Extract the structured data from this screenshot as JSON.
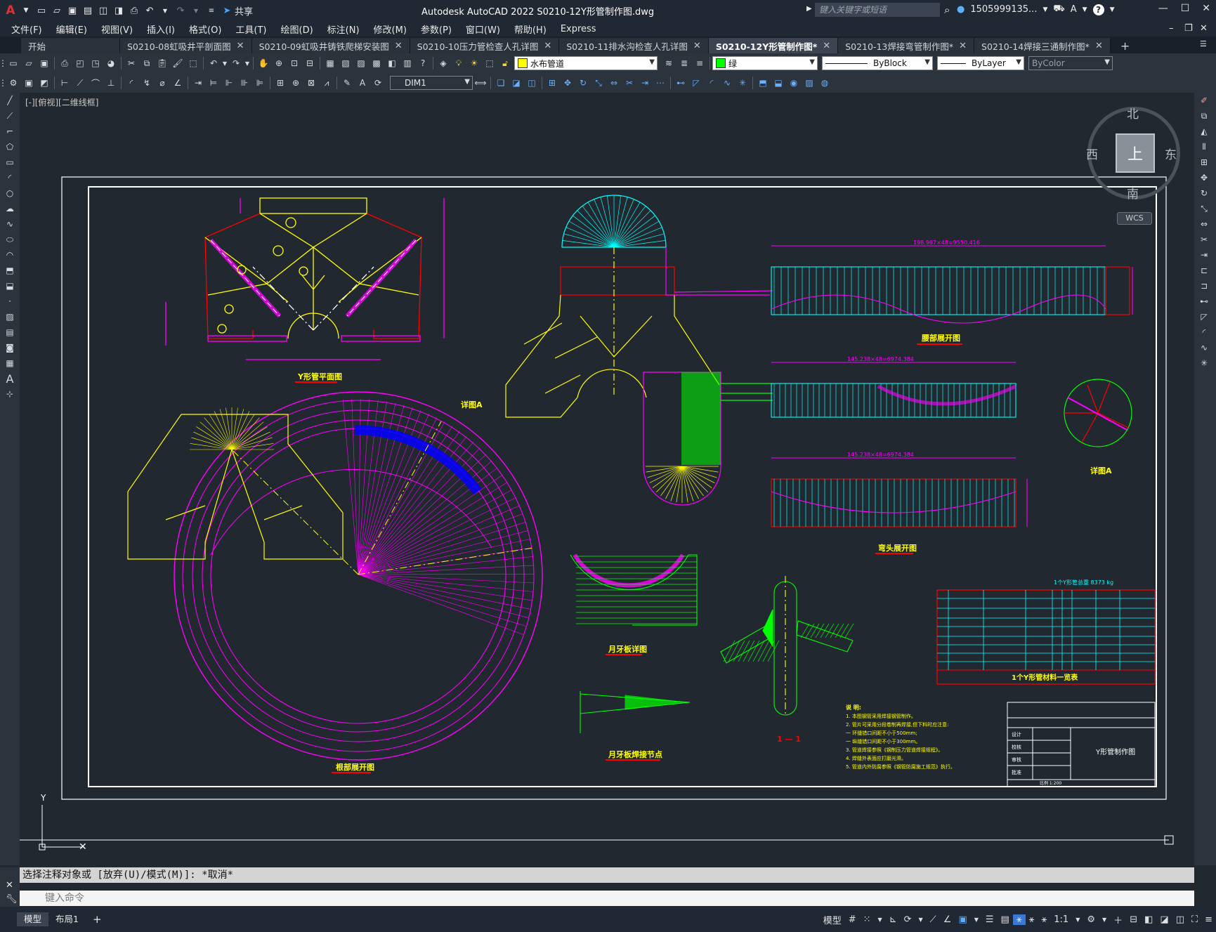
{
  "window": {
    "title": "Autodesk AutoCAD 2022    S0210-12Y形管制作图.dwg",
    "search_placeholder": "键入关键字或短语",
    "user": "1505999135...",
    "share_label": "共享"
  },
  "menu": [
    "文件(F)",
    "编辑(E)",
    "视图(V)",
    "插入(I)",
    "格式(O)",
    "工具(T)",
    "绘图(D)",
    "标注(N)",
    "修改(M)",
    "参数(P)",
    "窗口(W)",
    "帮助(H)",
    "Express"
  ],
  "tabs": [
    {
      "label": "开始",
      "active": false
    },
    {
      "label": "S0210-08虹吸井平剖面图",
      "active": false
    },
    {
      "label": "S0210-09虹吸井铸铁爬梯安装图",
      "active": false
    },
    {
      "label": "S0210-10压力管检查人孔详图",
      "active": false
    },
    {
      "label": "S0210-11排水沟检查人孔详图",
      "active": false
    },
    {
      "label": "S0210-12Y形管制作图*",
      "active": true
    },
    {
      "label": "S0210-13焊接弯管制作图*",
      "active": false
    },
    {
      "label": "S0210-14焊接三通制作图*",
      "active": false
    }
  ],
  "properties": {
    "layer": "水布管道",
    "layer_color": "#ffff00",
    "color_name": "绿",
    "color_hex": "#00ff00",
    "linetype": "ByBlock",
    "lineweight": "ByLayer",
    "plotstyle": "ByColor",
    "dimstyle": "DIM1"
  },
  "viewport_label": "[-][俯视][二维线框]",
  "viewcube": {
    "top": "上",
    "north": "北",
    "south": "南",
    "east": "东",
    "west": "西",
    "wcs": "WCS"
  },
  "drawing": {
    "titles": [
      "Y形管平面图",
      "腰部展开图",
      "弯头展开图",
      "根部展开图",
      "月牙板详图",
      "月牙板焊接节点",
      "详图A",
      "详图A",
      "1 — 1"
    ],
    "table_title": "1个Y形管材料一览表",
    "table_weight": "1个Y形管总重 8373 kg",
    "drawing_name": "Y形管制作图",
    "dims": [
      "198.967×48=9550.416",
      "145.238×48=6974.384",
      "145.238×48=6974.384"
    ],
    "table_rows": [
      [
        "4",
        "月牙板",
        "δ=20mm",
        "Q235A",
        "个",
        "1",
        "510",
        "510"
      ],
      [
        "3",
        "弯头(单节)",
        "DN2200",
        "Q235A",
        "个",
        "1",
        "2333",
        "4666"
      ],
      [
        "2",
        "腰部",
        "DN3000/DN2200",
        "Q235A",
        "个",
        "2",
        "972",
        "1944"
      ],
      [
        "1",
        "根部",
        "DN3000",
        "Q235A",
        "个",
        "1",
        "1263",
        "1263"
      ]
    ],
    "table_header": [
      "编号",
      "名称",
      "规格或型号",
      "材料",
      "单位",
      "数量",
      "单重(kg)",
      "总重(kg)",
      "备注"
    ],
    "notes_title": "说 明:",
    "notes": [
      "1. 本图钢管采用焊接钢管制作。",
      "2. 管片可采用分段卷制再焊接,但下料时应注意:",
      "   一 环缝错口间距不小于500mm;",
      "   一 纵缝错口间距不小于300mm。",
      "3. 管道焊接参照《钢制压力管道焊接规程》。",
      "4. 焊缝外表面应打磨光滑。",
      "5. 管道内外防腐参照《钢管防腐施工规范》执行。"
    ],
    "title_block": [
      "设计",
      "校核",
      "审核",
      "批准",
      "比例 1:200"
    ]
  },
  "command": {
    "output": "选择注释对象或 [放弃(U)/模式(M)]: *取消*",
    "placeholder": "键入命令"
  },
  "status": {
    "model_tab": "模型",
    "layout_tab": "布局1",
    "model_btn": "模型",
    "scale": "1:1"
  }
}
